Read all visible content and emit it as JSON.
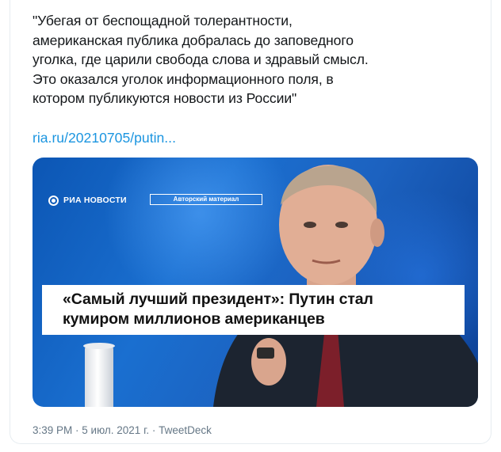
{
  "tweet": {
    "text": "\"Убегая от беспощадной толерантности,\nамериканская публика добралась до заповедного\nуголка, где царили свобода слова и здравый смысл.\nЭто оказался уголок информационного поля, в\nкотором публикуются новости из России\"",
    "link": "ria.ru/20210705/putin...",
    "meta": "3:39 PM · 5 июл. 2021 г. · TweetDeck"
  },
  "media": {
    "logo": "РИА НОВОСТИ",
    "tag": "Авторский материал",
    "headline": "«Самый лучший президент»: Путин стал\nкумиром миллионов американцев"
  },
  "colors": {
    "link": "#1b95e0",
    "text": "#14171a",
    "meta": "#657786",
    "media_blue": "#1a6fd0"
  }
}
